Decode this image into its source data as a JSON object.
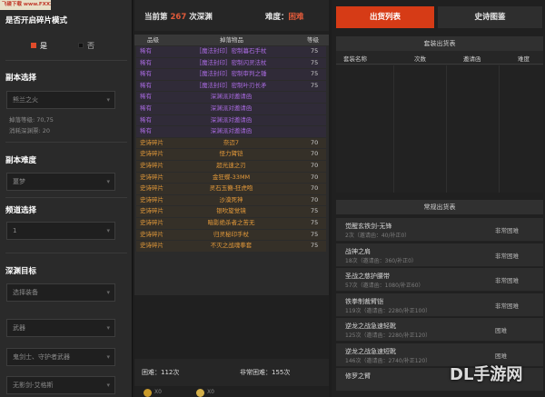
{
  "watermark_top": "飞碟下载 www.FXXZ.com",
  "sidebar": {
    "shard_mode_title": "是否开启碎片模式",
    "opt_yes": "是",
    "opt_no": "否",
    "dungeon_title": "副本选择",
    "dungeon_value": "熊兰之火",
    "dungeon_level": "掉落等级: 70,75",
    "dungeon_fatigue": "消耗深渊票: 20",
    "difficulty_title": "副本难度",
    "difficulty_value": "噩梦",
    "channel_title": "频道选择",
    "channel_value": "1",
    "target_title": "深渊目标",
    "target_equip": "选择装备",
    "target_weapon": "武器",
    "target_class": "鬼剑士、守护者武器",
    "target_item": "无影剑-艾格斯"
  },
  "center": {
    "header_prefix": "当前第",
    "header_count": "267",
    "header_suffix": "次深渊",
    "difficulty_label": "难度：",
    "difficulty_value": "困难",
    "col_grade": "品级",
    "col_item": "掉落物品",
    "col_level": "等级",
    "rows": [
      {
        "grade": "稀有",
        "item": "［魔法封印］密制暮石手杖",
        "level": "75",
        "tone": "rare"
      },
      {
        "grade": "稀有",
        "item": "［魔法封印］密制闪灵法杖",
        "level": "75",
        "tone": "rare"
      },
      {
        "grade": "稀有",
        "item": "［魔法封印］密制审判之锤",
        "level": "75",
        "tone": "rare"
      },
      {
        "grade": "稀有",
        "item": "［魔法封印］密制叶刃长矛",
        "level": "75",
        "tone": "rare"
      },
      {
        "grade": "稀有",
        "item": "深渊派对邀请函",
        "level": "",
        "tone": "rare"
      },
      {
        "grade": "稀有",
        "item": "深渊派对邀请函",
        "level": "",
        "tone": "rare"
      },
      {
        "grade": "稀有",
        "item": "深渊派对邀请函",
        "level": "",
        "tone": "rare"
      },
      {
        "grade": "稀有",
        "item": "深渊派对邀请函",
        "level": "",
        "tone": "rare"
      },
      {
        "grade": "史诗碎片",
        "item": "奈迈7",
        "level": "70",
        "tone": "epic"
      },
      {
        "grade": "史诗碎片",
        "item": "怪力臂铠",
        "level": "70",
        "tone": "epic"
      },
      {
        "grade": "史诗碎片",
        "item": "超光速之刃",
        "level": "70",
        "tone": "epic"
      },
      {
        "grade": "史诗碎片",
        "item": "金狂蝶-33MM",
        "level": "70",
        "tone": "epic"
      },
      {
        "grade": "史诗碎片",
        "item": "灵石玉簪-狂虎咆",
        "level": "70",
        "tone": "epic"
      },
      {
        "grade": "史诗碎片",
        "item": "沙漠死神",
        "level": "70",
        "tone": "epic"
      },
      {
        "grade": "史诗碎片",
        "item": "银吹旋觉镜",
        "level": "75",
        "tone": "epic"
      },
      {
        "grade": "史诗碎片",
        "item": "暗影绝杀者之苦无",
        "level": "75",
        "tone": "epic"
      },
      {
        "grade": "史诗碎片",
        "item": "归灵秘印手杖",
        "level": "75",
        "tone": "epic"
      },
      {
        "grade": "史诗碎片",
        "item": "不灭之战魂拳套",
        "level": "75",
        "tone": "epic"
      }
    ],
    "stat_difficulty": "困难：112次",
    "stat_nightmare": "非常困难：155次",
    "footer_count": "X0"
  },
  "right": {
    "tab_active": "出货列表",
    "tab_other": "史诗图鉴",
    "set_panel_title": "套装出货表",
    "set_col_name": "套装名称",
    "set_col_count": "次数",
    "set_col_ticket": "邀请函",
    "set_col_diff": "难度",
    "normal_panel_title": "常规出货表",
    "items": [
      {
        "name": "觉醒玄铁剑-无锋",
        "sub": "2次（邀请函：40/补正0）",
        "diff": "非常困难"
      },
      {
        "name": "战神之肩",
        "sub": "18次（邀请函：360/补正0）",
        "diff": "非常困难"
      },
      {
        "name": "圣战之慈护腰带",
        "sub": "57次（邀请函：1080/补正60）",
        "diff": "非常困难"
      },
      {
        "name": "铁拳制裁臂铠",
        "sub": "119次（邀请函：2280/补正100）",
        "diff": "非常困难"
      },
      {
        "name": "逆龙之战急速轻靴",
        "sub": "125次（邀请函：2280/补正120）",
        "diff": "困难"
      },
      {
        "name": "逆龙之战急速短靴",
        "sub": "146次（邀请函：2740/补正120）",
        "diff": "困难"
      },
      {
        "name": "修罗之臂",
        "sub": "",
        "diff": ""
      }
    ],
    "watermark": "DL手游网"
  },
  "colors": {
    "rare": "#a96be0",
    "epic": "#e49a3a",
    "accent_red": "#e05a3a",
    "tab_active": "#d63b16"
  }
}
